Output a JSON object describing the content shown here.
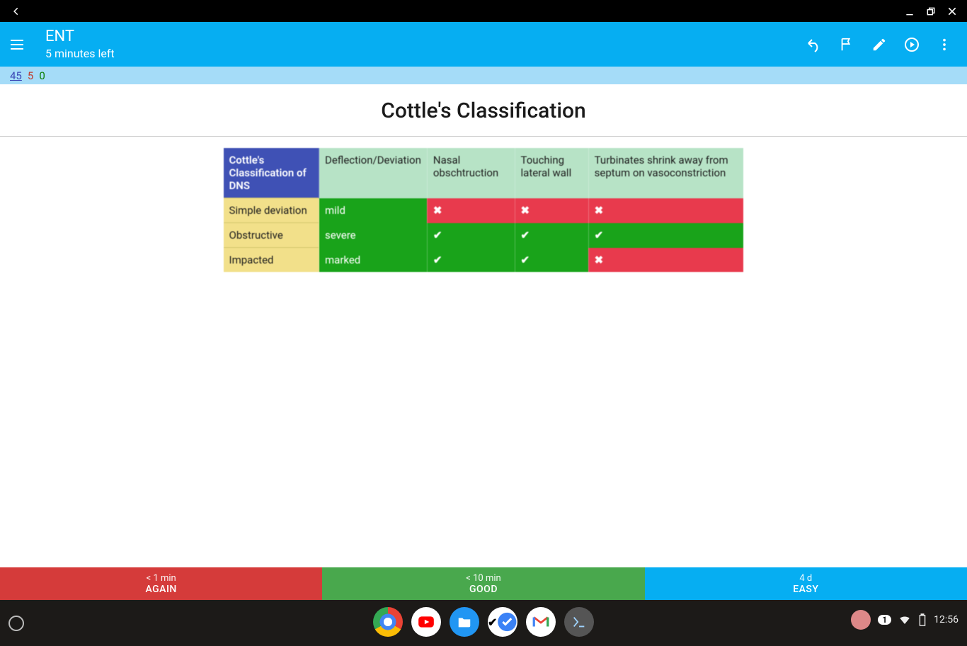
{
  "header": {
    "deck_title": "ENT",
    "time_left": "5 minutes left"
  },
  "counts": {
    "new": "45",
    "learn": "5",
    "review": "0"
  },
  "card": {
    "question": "Cottle's Classification",
    "table": {
      "corner_header": "Cottle's Classification of DNS",
      "col_headers": [
        "Deflection/Deviation",
        "Nasal obschtruction",
        "Touching lateral wall",
        "Turbinates shrink away from septum on vasoconstriction"
      ],
      "rows": [
        {
          "label": "Simple deviation",
          "cells": [
            {
              "text": "mild",
              "kind": "green"
            },
            {
              "kind": "red",
              "mark": "cross"
            },
            {
              "kind": "red",
              "mark": "cross"
            },
            {
              "kind": "red",
              "mark": "cross"
            }
          ]
        },
        {
          "label": "Obstructive",
          "cells": [
            {
              "text": "severe",
              "kind": "green"
            },
            {
              "kind": "green",
              "mark": "tick"
            },
            {
              "kind": "green",
              "mark": "tick"
            },
            {
              "kind": "green",
              "mark": "tick"
            }
          ]
        },
        {
          "label": "Impacted",
          "cells": [
            {
              "text": "marked",
              "kind": "green"
            },
            {
              "kind": "green",
              "mark": "tick"
            },
            {
              "kind": "green",
              "mark": "tick"
            },
            {
              "kind": "red",
              "mark": "cross"
            }
          ]
        }
      ]
    }
  },
  "answers": {
    "again": {
      "time": "< 1 min",
      "label": "AGAIN"
    },
    "good": {
      "time": "< 10 min",
      "label": "GOOD"
    },
    "easy": {
      "time": "4 d",
      "label": "EASY"
    }
  },
  "tray": {
    "notif_count": "1",
    "clock": "12:56"
  }
}
